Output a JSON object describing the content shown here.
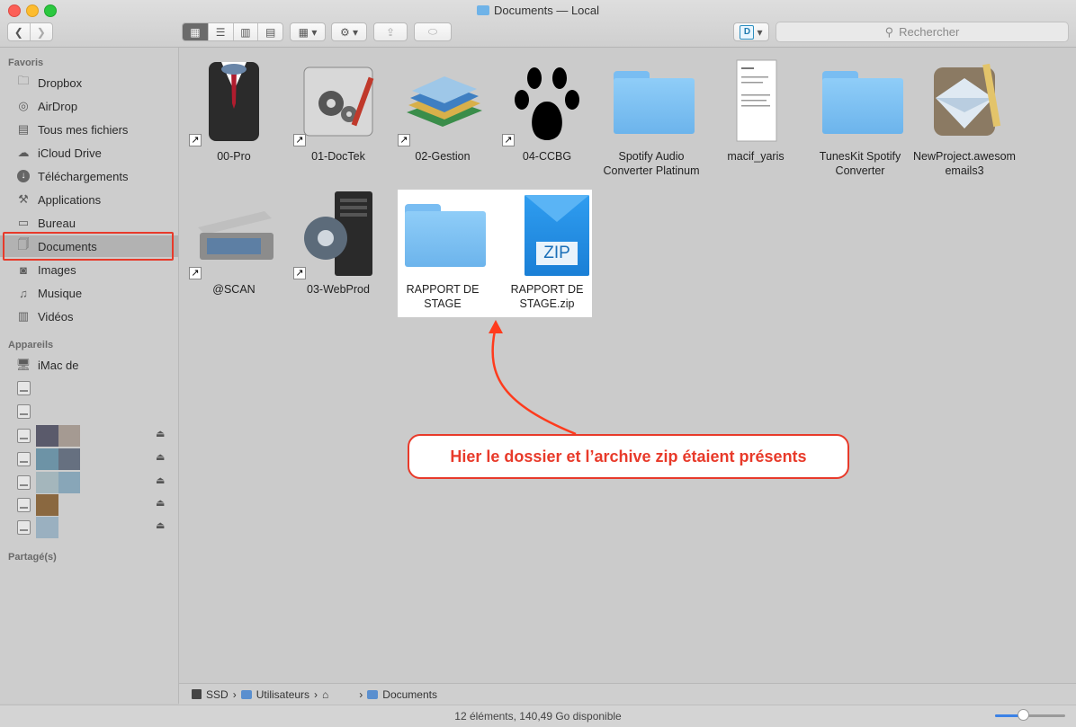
{
  "window": {
    "title": "Documents — Local",
    "traffic_lights": {
      "close": "#fc5f57",
      "minimize": "#fdbc2e",
      "zoom": "#2bc83f"
    }
  },
  "toolbar": {
    "back_icon": "chevron-left-icon",
    "forward_icon": "chevron-right-icon",
    "view_modes": [
      "icon-view",
      "list-view",
      "column-view",
      "cover-flow-view"
    ],
    "arrange_icon": "arrange-icon",
    "action_icon": "gear-icon",
    "share_icon": "share-icon",
    "tag_icon": "tag-icon",
    "dashlane_label": "D",
    "search_placeholder": "Rechercher"
  },
  "sidebar": {
    "favorites_header": "Favoris",
    "favorites": [
      {
        "label": "Dropbox",
        "icon": "folder-icon"
      },
      {
        "label": "AirDrop",
        "icon": "airdrop-icon"
      },
      {
        "label": "Tous mes fichiers",
        "icon": "all-files-icon"
      },
      {
        "label": "iCloud Drive",
        "icon": "cloud-icon"
      },
      {
        "label": "Téléchargements",
        "icon": "download-icon"
      },
      {
        "label": "Applications",
        "icon": "applications-icon"
      },
      {
        "label": "Bureau",
        "icon": "desktop-icon"
      },
      {
        "label": "Documents",
        "icon": "documents-icon",
        "selected": true
      },
      {
        "label": "Images",
        "icon": "camera-icon"
      },
      {
        "label": "Musique",
        "icon": "music-icon"
      },
      {
        "label": "Vidéos",
        "icon": "film-icon"
      }
    ],
    "devices_header": "Appareils",
    "imac_label": "iMac de",
    "shared_header": "Partagé(s)"
  },
  "files": [
    {
      "name": "00-Pro",
      "alias": true
    },
    {
      "name": "01-DocTek",
      "alias": true
    },
    {
      "name": "02-Gestion",
      "alias": true
    },
    {
      "name": "04-CCBG",
      "alias": true
    },
    {
      "name": "Spotify Audio Converter Platinum",
      "alias": false
    },
    {
      "name": "macif_yaris",
      "alias": false
    },
    {
      "name": "TunesKit Spotify Converter",
      "alias": false
    },
    {
      "name": "NewProject.awesomemails3",
      "alias": false
    },
    {
      "name": "@SCAN",
      "alias": true
    },
    {
      "name": "03-WebProd",
      "alias": true
    },
    {
      "name": "RAPPORT DE STAGE",
      "alias": false
    },
    {
      "name": "RAPPORT DE STAGE.zip",
      "alias": false
    }
  ],
  "zip_badge": "ZIP",
  "alias_glyph": "↗",
  "pathbar": [
    "SSD",
    "Utilisateurs",
    "Documents"
  ],
  "status": "12 éléments, 140,49 Go disponible",
  "icon_size_slider": 0.4,
  "callout": {
    "text": "Hier le dossier et l’archive zip étaient présents",
    "color": "#e83a2a"
  }
}
